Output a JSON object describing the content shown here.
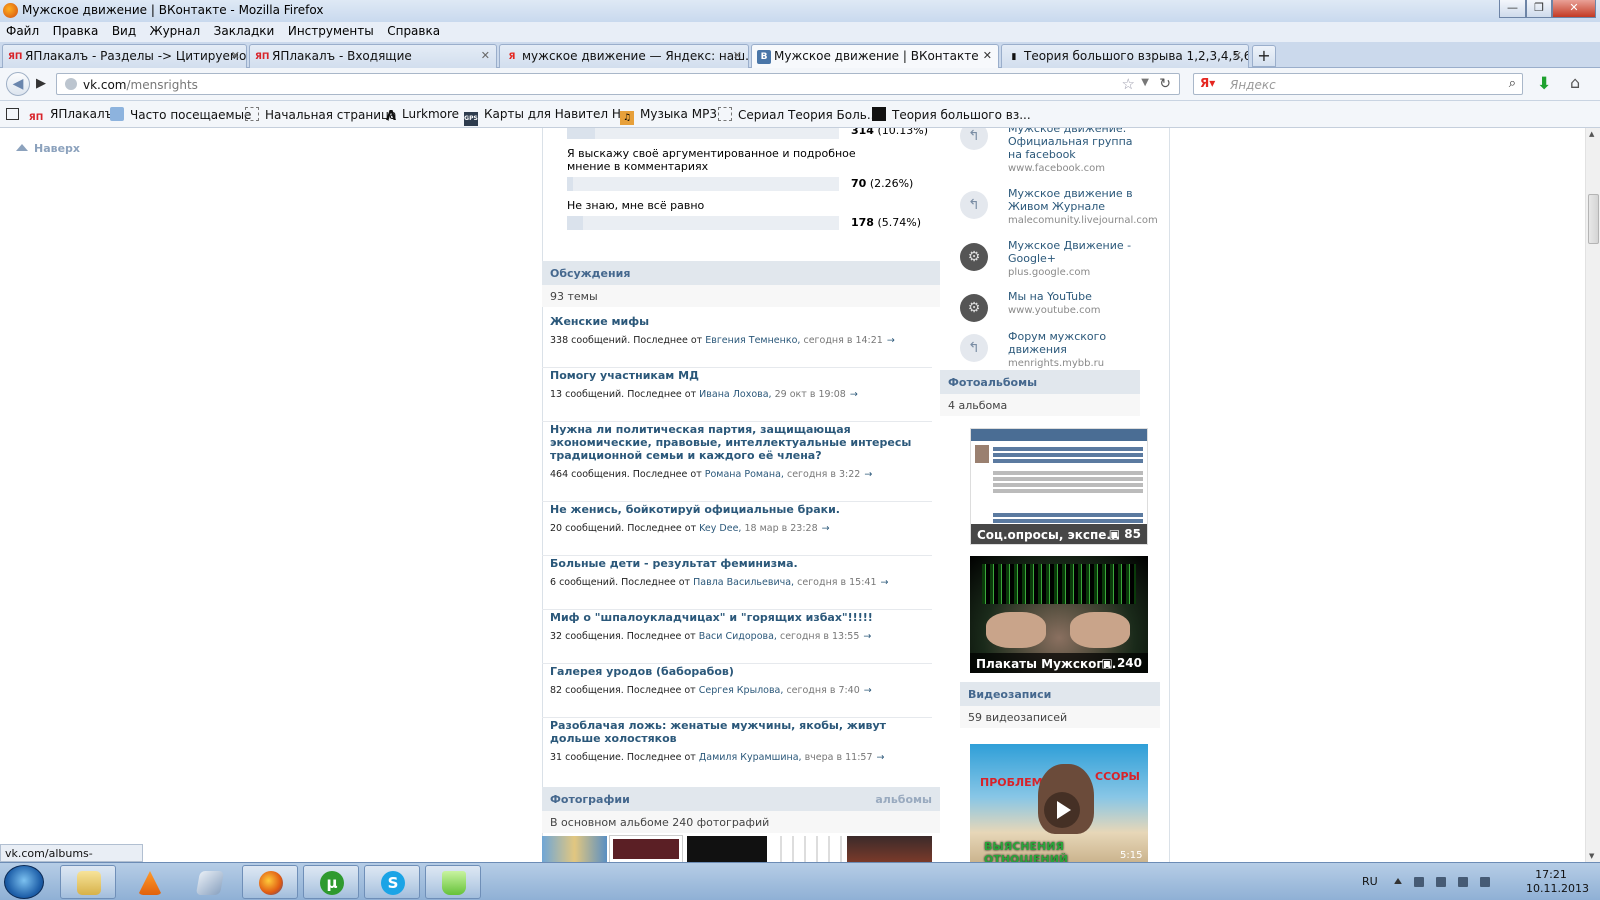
{
  "window": {
    "title": "Мужское движение | ВКонтакте - Mozilla Firefox",
    "controls": [
      "—",
      "❐",
      "✕"
    ]
  },
  "menu": [
    "Файл",
    "Правка",
    "Вид",
    "Журнал",
    "Закладки",
    "Инструменты",
    "Справка"
  ],
  "tabs": [
    {
      "label": "ЯПлакалъ - Разделы -> Цитируемо...",
      "icon": "ЯП",
      "icon_color": "#d8232a"
    },
    {
      "label": "ЯПлакалъ - Входящие",
      "icon": "ЯП",
      "icon_color": "#d8232a"
    },
    {
      "label": "мужское движение — Яндекс: наш...",
      "icon": "Я",
      "icon_color": "#e52620"
    },
    {
      "label": "Мужское движение | ВКонтакте",
      "icon": "В",
      "icon_color": "#4a76a8",
      "active": true
    },
    {
      "label": "Теория большого взрыва 1,2,3,4,5,6...",
      "icon": "▮",
      "icon_color": "#111"
    }
  ],
  "nav": {
    "url_host": "vk.com",
    "url_path": "/mensrights",
    "search_placeholder": "Яндекс"
  },
  "bookmarks": [
    {
      "label": "ЯПлакалъ",
      "icon": "ЯП"
    },
    {
      "label": "Часто посещаемые",
      "icon": "○"
    },
    {
      "label": "Начальная страница",
      "icon": ""
    },
    {
      "label": "Lurkmore",
      "icon": "Λ"
    },
    {
      "label": "Карты для Навител Н...",
      "icon": "GPS"
    },
    {
      "label": "Музыка MP3",
      "icon": "♫"
    },
    {
      "label": "Сериал Теория Боль...",
      "icon": ""
    },
    {
      "label": "Теория большого вз...",
      "icon": "▮"
    }
  ],
  "page": {
    "naverh": "Наверх",
    "poll": [
      {
        "question": "",
        "count": "314",
        "pct": "(10.13%)",
        "fraction": 0.1013
      },
      {
        "question": "Я выскажу своё аргументированное и подробное мнение в комментариях",
        "count": "70",
        "pct": "(2.26%)",
        "fraction": 0.0226
      },
      {
        "question": "Не знаю, мне всё равно",
        "count": "178",
        "pct": "(5.74%)",
        "fraction": 0.0574
      }
    ],
    "discussions": {
      "title": "Обсуждения",
      "subtitle": "93 темы",
      "topics": [
        {
          "title": "Женские мифы",
          "meta": "338 сообщений. Последнее от",
          "author": "Евгения Темненко,",
          "date": "сегодня в 14:21"
        },
        {
          "title": "Помогу участникам МД",
          "meta": "13 сообщений. Последнее от",
          "author": "Ивана Лохова,",
          "date": "29 окт в 19:08"
        },
        {
          "title": "Нужна ли политическая партия, защищающая экономические, правовые, интеллектуальные интересы традиционной семьи и каждого её члена?",
          "meta": "464 сообщения. Последнее от",
          "author": "Романа Романа,",
          "date": "сегодня в 3:22"
        },
        {
          "title": "Не женись, бойкотируй официальные браки.",
          "meta": "20 сообщений. Последнее от",
          "author": "Key Dee,",
          "date": "18 мар в 23:28"
        },
        {
          "title": "Больные дети - результат феминизма.",
          "meta": "6 сообщений. Последнее от",
          "author": "Павла Васильевича,",
          "date": "сегодня в 15:41"
        },
        {
          "title": "Миф о \"шпалоукладчицах\" и \"горящих избах\"!!!!!",
          "meta": "32 сообщения. Последнее от",
          "author": "Васи Сидорова,",
          "date": "сегодня в 13:55"
        },
        {
          "title": "Галерея уродов (баборабов)",
          "meta": "82 сообщения. Последнее от",
          "author": "Сергея Крылова,",
          "date": "сегодня в 7:40"
        },
        {
          "title": "Разоблачая ложь: женатые мужчины, якобы, живут дольше холостяков",
          "meta": "31 сообщение. Последнее от",
          "author": "Дамиля Курамшина,",
          "date": "вчера в 11:57"
        }
      ]
    },
    "photos": {
      "title": "Фотографии",
      "albums_link": "альбомы",
      "subtitle": "В основном альбоме 240 фотографий"
    },
    "links": [
      {
        "name": "Мужское движение: Официальная группа на facebook",
        "url": "www.facebook.com"
      },
      {
        "name": "Мужское движение в Живом Журнале",
        "url": "malecomunity.livejournal.com"
      },
      {
        "name": "Мужское Движение - Google+",
        "url": "plus.google.com"
      },
      {
        "name": "Мы на YouTube",
        "url": "www.youtube.com"
      },
      {
        "name": "Форум мужского движения",
        "url": "menrights.mybb.ru"
      }
    ],
    "photoalbums": {
      "title": "Фотоальбомы",
      "subtitle": "4 альбома",
      "albums": [
        {
          "label": "Соц.опросы, экспе...",
          "count": "85"
        },
        {
          "label": "Плакаты Мужског...",
          "count": "240"
        }
      ]
    },
    "videos": {
      "title": "Видеозаписи",
      "subtitle": "59 видеозаписей",
      "thumb_text_top_left": "ПРОБЛЕМЫ",
      "thumb_text_top_right": "ССОРЫ",
      "thumb_text_bottom": "ВЫЯСНЕНИЯ ОТНОШЕНИЙ",
      "duration": "5:15"
    }
  },
  "status_url": "vk.com/albums-12208571",
  "taskbar": {
    "lang": "RU",
    "time": "17:21",
    "date": "10.11.2013"
  }
}
